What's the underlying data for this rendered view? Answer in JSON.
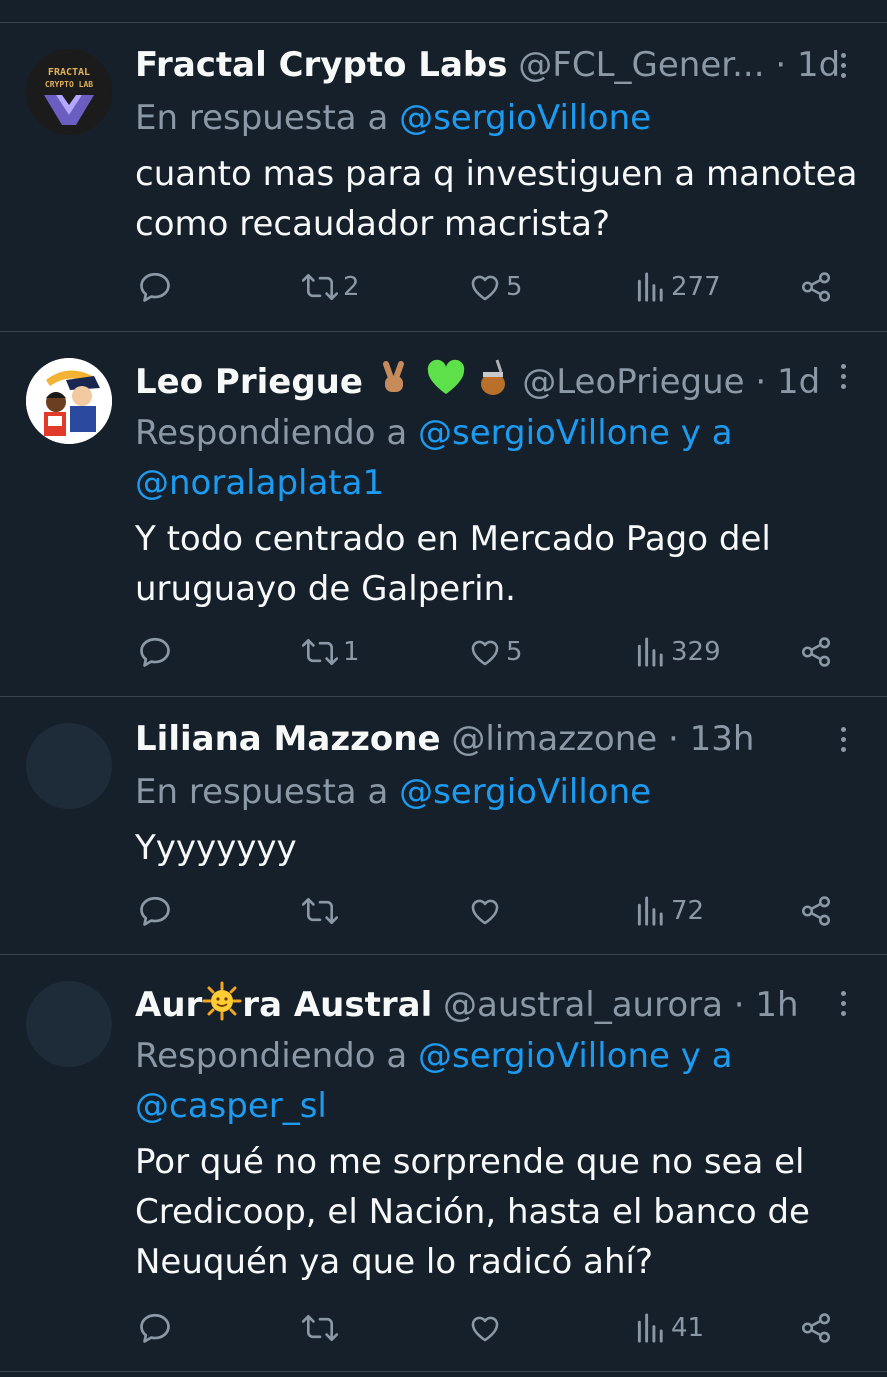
{
  "tweets": [
    {
      "name": "Fractal Crypto Labs",
      "handle": "@FCL_Gener...",
      "time": "· 1d",
      "reply_prefix": "En respuesta a",
      "reply_mention": "@sergioVillone",
      "text_lines": [
        "cuanto mas para q investiguen a manotea",
        "como recaudador macrista?"
      ],
      "avatar_text": [
        "FRACTAL",
        "CRYPTO LAB"
      ],
      "retweets": "2",
      "likes": "5",
      "views": "277"
    },
    {
      "name": "Leo Priegue",
      "handle": "@LeoPriegue",
      "time": "· 1d",
      "reply_prefix": "Respondiendo a",
      "reply_mention": "@sergioVillone y a",
      "reply_mention2": "@noralaplata1",
      "text_lines": [
        "Y todo centrado en Mercado Pago del",
        "uruguayo de Galperin."
      ],
      "retweets": "1",
      "likes": "5",
      "views": "329"
    },
    {
      "name": "Liliana Mazzone",
      "handle": "@limazzone",
      "time": "· 13h",
      "reply_prefix": "En respuesta a",
      "reply_mention": "@sergioVillone",
      "text_lines": [
        "Yyyyyyyy"
      ],
      "retweets": "",
      "likes": "",
      "views": "72"
    },
    {
      "name_part1": "Aur",
      "name_part2": "ra Austral",
      "handle": "@austral_aurora",
      "time": "· 1h",
      "reply_prefix": "Respondiendo a",
      "reply_mention": "@sergioVillone y a",
      "reply_mention2": "@casper_sl",
      "text_lines": [
        "Por qué no me sorprende que no sea el",
        "Credicoop, el Nación, hasta el banco de",
        "Neuquén ya que lo radicó ahí?"
      ],
      "retweets": "",
      "likes": "",
      "views": "41"
    }
  ],
  "colors": {
    "background": "#15202b",
    "divider": "#38444d",
    "secondary_text": "#8b98a5",
    "link": "#1d9bf0"
  },
  "icons": [
    "reply-icon",
    "retweet-icon",
    "heart-icon",
    "views-icon",
    "share-icon",
    "more-icon"
  ]
}
